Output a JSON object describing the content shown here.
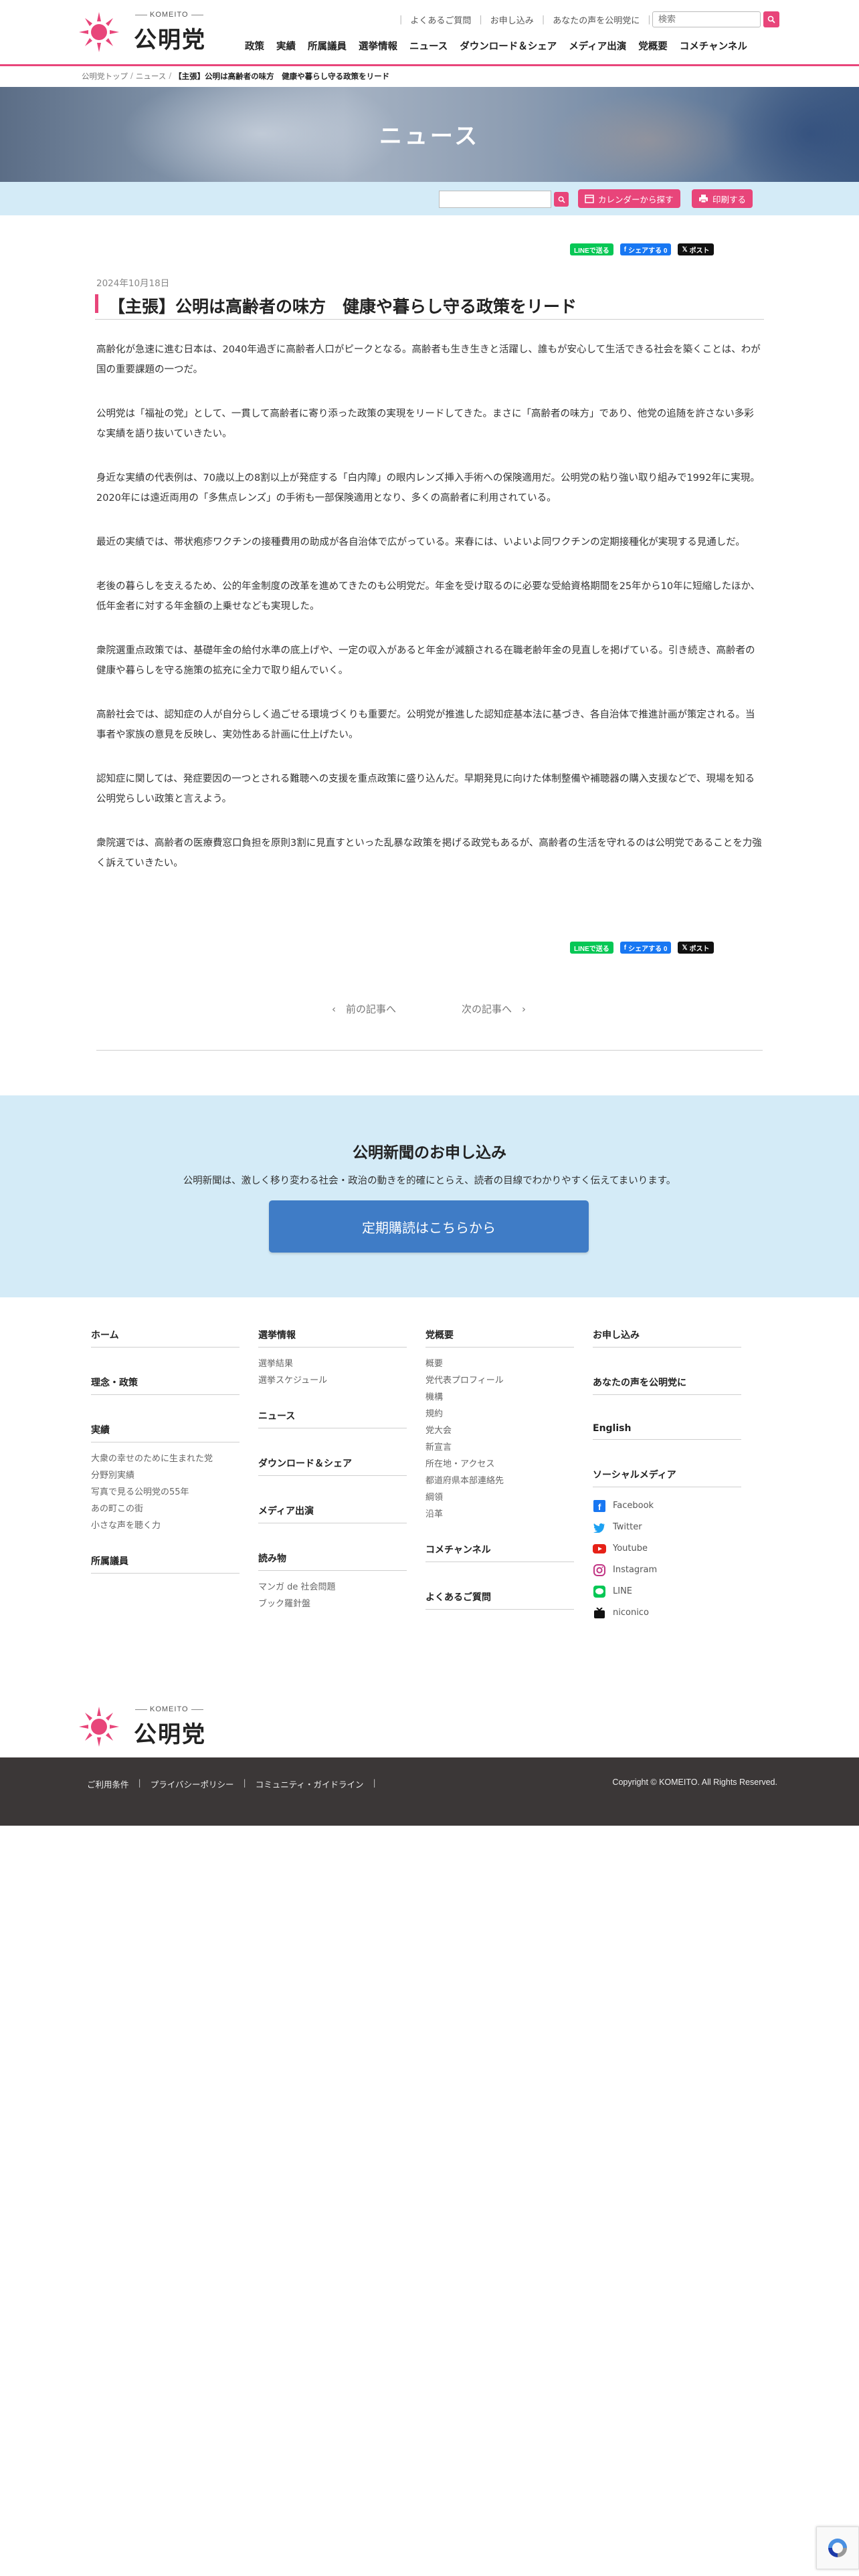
{
  "header": {
    "logo_en": "KOMEITO",
    "logo_jp": "公明党",
    "util_links": [
      "よくあるご質問",
      "お申し込み",
      "あなたの声を公明党に"
    ],
    "search_placeholder": "検索",
    "nav": [
      "政策",
      "実績",
      "所属議員",
      "選挙情報",
      "ニュース",
      "ダウンロード＆シェア",
      "メディア出演",
      "党概要",
      "コメチャンネル"
    ]
  },
  "breadcrumb": {
    "items": [
      "公明党トップ",
      "ニュース"
    ],
    "current": "【主張】公明は高齢者の味方　健康や暮らし守る政策をリード"
  },
  "hero": {
    "title": "ニュース"
  },
  "toolbar": {
    "calendar_label": "カレンダーから探す",
    "print_label": "印刷する"
  },
  "share": {
    "line": "LINEで送る",
    "facebook": "シェアする 0",
    "x": "ポスト"
  },
  "article": {
    "date": "2024年10月18日",
    "title": "【主張】公明は高齢者の味方　健康や暮らし守る政策をリード",
    "paragraphs": [
      "高齢化が急速に進む日本は、2040年過ぎに高齢者人口がピークとなる。高齢者も生き生きと活躍し、誰もが安心して生活できる社会を築くことは、わが国の重要課題の一つだ。",
      "公明党は「福祉の党」として、一貫して高齢者に寄り添った政策の実現をリードしてきた。まさに「高齢者の味方」であり、他党の追随を許さない多彩な実績を語り抜いていきたい。",
      "身近な実績の代表例は、70歳以上の8割以上が発症する「白内障」の眼内レンズ挿入手術への保険適用だ。公明党の粘り強い取り組みで1992年に実現。2020年には遠近両用の「多焦点レンズ」の手術も一部保険適用となり、多くの高齢者に利用されている。",
      "最近の実績では、帯状疱疹ワクチンの接種費用の助成が各自治体で広がっている。来春には、いよいよ同ワクチンの定期接種化が実現する見通しだ。",
      "老後の暮らしを支えるため、公的年金制度の改革を進めてきたのも公明党だ。年金を受け取るのに必要な受給資格期間を25年から10年に短縮したほか、低年金者に対する年金額の上乗せなども実現した。",
      "衆院選重点政策では、基礎年金の給付水準の底上げや、一定の収入があると年金が減額される在職老齢年金の見直しを掲げている。引き続き、高齢者の健康や暮らしを守る施策の拡充に全力で取り組んでいく。",
      "高齢社会では、認知症の人が自分らしく過ごせる環境づくりも重要だ。公明党が推進した認知症基本法に基づき、各自治体で推進計画が策定される。当事者や家族の意見を反映し、実効性ある計画に仕上げたい。",
      "認知症に関しては、発症要因の一つとされる難聴への支援を重点政策に盛り込んだ。早期発見に向けた体制整備や補聴器の購入支援などで、現場を知る公明党らしい政策と言えよう。",
      "衆院選では、高齢者の医療費窓口負担を原則3割に見直すといった乱暴な政策を掲げる政党もあるが、高齢者の生活を守れるのは公明党であることを力強く訴えていきたい。"
    ],
    "prev_label": "‹　前の記事へ",
    "next_label": "次の記事へ　›"
  },
  "subscribe": {
    "title": "公明新聞のお申し込み",
    "desc": "公明新聞は、激しく移り変わる社会・政治の動きを的確にとらえ、読者の目線でわかりやすく伝えてまいります。",
    "button": "定期購読はこちらから"
  },
  "footer": {
    "col1": {
      "home": "ホーム",
      "philosophy": "理念・政策",
      "achievements": "実績",
      "achievement_items": [
        "大衆の幸せのために生まれた党",
        "分野別実績",
        "写真で見る公明党の55年",
        "あの町この街",
        "小さな声を聴く力"
      ],
      "members": "所属議員"
    },
    "col2": {
      "election": "選挙情報",
      "election_items": [
        "選挙結果",
        "選挙スケジュール"
      ],
      "news": "ニュース",
      "download": "ダウンロード＆シェア",
      "media": "メディア出演",
      "reading": "読み物",
      "reading_items": [
        "マンガ de 社会問題",
        "ブック羅針盤"
      ]
    },
    "col3": {
      "overview": "党概要",
      "overview_items": [
        "概要",
        "党代表プロフィール",
        "機構",
        "規約",
        "党大会",
        "新宣言",
        "所在地・アクセス",
        "都道府県本部連絡先",
        "綱領",
        "沿革"
      ],
      "comechannel": "コメチャンネル",
      "faq": "よくあるご質問"
    },
    "col4": {
      "apply": "お申し込み",
      "voice": "あなたの声を公明党に",
      "english": "English",
      "social": "ソーシャルメディア",
      "social_items": [
        "Facebook",
        "Twitter",
        "Youtube",
        "Instagram",
        "LINE",
        "niconico"
      ]
    },
    "bottom_links": [
      "ご利用条件",
      "プライバシーポリシー",
      "コミュニティ・ガイドライン"
    ],
    "copyright": "Copyright © KOMEITO. All Rights Reserved."
  },
  "colors": {
    "accent": "#e8457a",
    "light_blue": "#d4ebf7",
    "button_blue": "#3f7cc6",
    "footer_dark": "#3b3737"
  }
}
